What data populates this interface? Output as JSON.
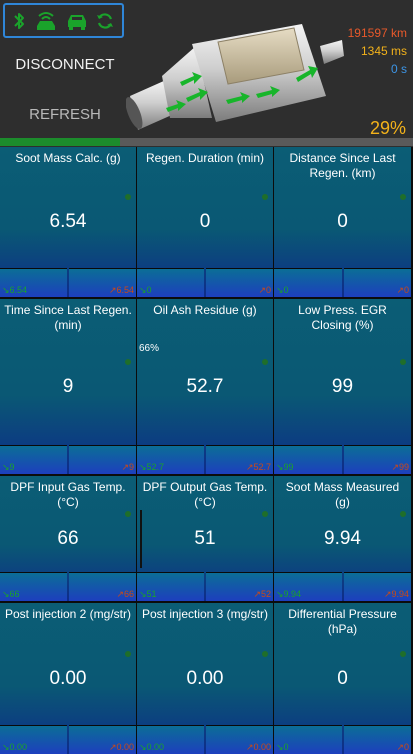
{
  "status_icons": [
    "bluetooth-icon",
    "wifi-car-icon",
    "car-icon",
    "sync-icon"
  ],
  "buttons": {
    "disconnect": "DISCONNECT",
    "refresh": "REFRESH"
  },
  "stats": {
    "mileage": "191597 km",
    "latency": "1345 ms",
    "elapsed": "0 s",
    "regen_percent": "29%"
  },
  "progress_fraction": 0.29,
  "tiles": [
    {
      "title": "Soot Mass Calc. (g)",
      "value": "6.54",
      "min": "↘6.54",
      "max": "↗6.54"
    },
    {
      "title": "Regen. Duration (min)",
      "value": "0",
      "min": "↘0",
      "max": "↗0"
    },
    {
      "title": "Distance Since Last Regen. (km)",
      "value": "0",
      "min": "↘0",
      "max": "↗0"
    },
    {
      "title": "Time Since Last Regen. (min)",
      "value": "9",
      "min": "↘9",
      "max": "↗9"
    },
    {
      "title": "Oil Ash Residue (g)",
      "value": "52.7",
      "min": "↘52.7",
      "max": "↗52.7",
      "percent": "66%"
    },
    {
      "title": "Low Press. EGR Closing (%)",
      "value": "99",
      "min": "↘99",
      "max": "↗99"
    },
    {
      "title": "DPF Input Gas Temp. (°C)",
      "value": "66",
      "min": "↘66",
      "max": "↗66"
    },
    {
      "title": "DPF Output Gas Temp. (°C)",
      "value": "51",
      "min": "↘51",
      "max": "↗52"
    },
    {
      "title": "Soot Mass Measured (g)",
      "value": "9.94",
      "min": "↘9.94",
      "max": "↗9.94"
    },
    {
      "title": "Post injection 2 (mg/str)",
      "value": "0.00",
      "min": "↘0.00",
      "max": "↗0.00"
    },
    {
      "title": "Post injection 3 (mg/str)",
      "value": "0.00",
      "min": "↘0.00",
      "max": "↗0.00"
    },
    {
      "title": "Differential Pressure (hPa)",
      "value": "0",
      "min": "↘0",
      "max": "↗0"
    }
  ],
  "colors": {
    "accent_green": "#1c8c2c",
    "stat_red": "#e8592b",
    "stat_amber": "#f3b21a",
    "stat_blue": "#3d95e6",
    "border_blue": "#2f86d8"
  }
}
